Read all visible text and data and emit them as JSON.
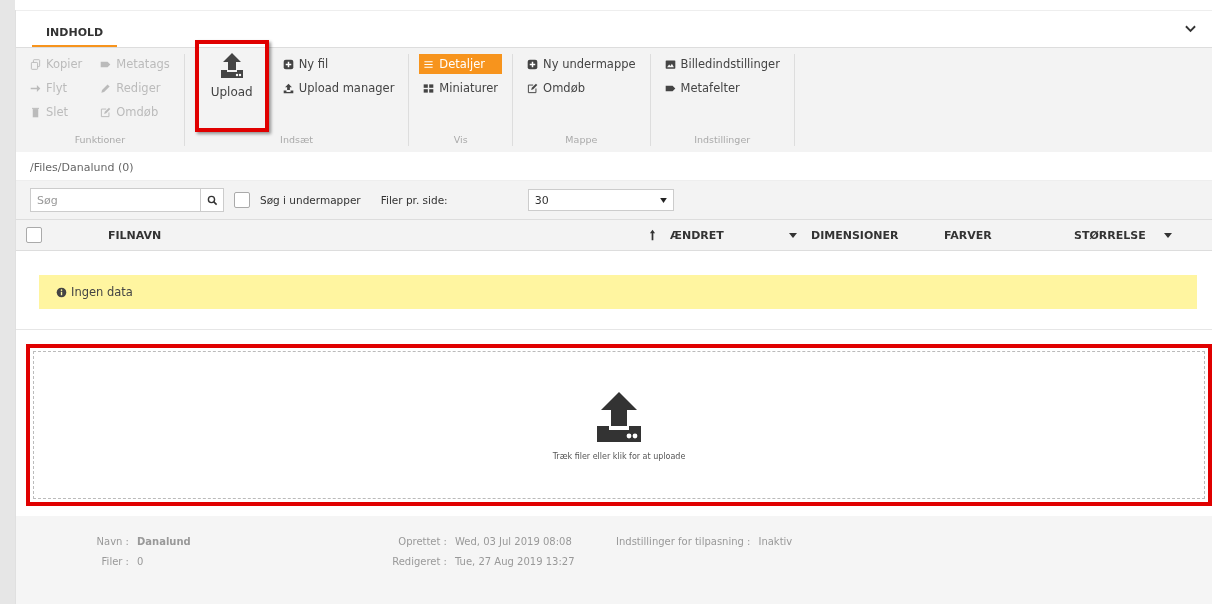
{
  "tabs": [
    {
      "label": "INDHOLD",
      "selected": true
    }
  ],
  "ribbon": {
    "groups": [
      {
        "label": "Funktioner",
        "columns": [
          [
            {
              "label": "Kopier",
              "disabled": true
            },
            {
              "label": "Flyt",
              "disabled": true
            },
            {
              "label": "Slet",
              "disabled": true
            }
          ],
          [
            {
              "label": "Metatags",
              "disabled": true
            },
            {
              "label": "Rediger",
              "disabled": true
            },
            {
              "label": "Omdøb",
              "disabled": true
            }
          ]
        ]
      },
      {
        "label": "Indsæt",
        "big": {
          "label": "Upload",
          "highlighted": true
        },
        "columns": [
          [
            {
              "label": "Ny fil",
              "disabled": false
            },
            {
              "label": "Upload manager",
              "disabled": false
            }
          ]
        ]
      },
      {
        "label": "Vis",
        "columns": [
          [
            {
              "label": "Detaljer",
              "selected": true
            },
            {
              "label": "Miniaturer",
              "selected": false
            }
          ]
        ]
      },
      {
        "label": "Mappe",
        "columns": [
          [
            {
              "label": "Ny undermappe",
              "disabled": false
            },
            {
              "label": "Omdøb",
              "disabled": false
            }
          ]
        ]
      },
      {
        "label": "Indstillinger",
        "columns": [
          [
            {
              "label": "Billedindstillinger",
              "disabled": false
            },
            {
              "label": "Metafelter",
              "disabled": false
            }
          ]
        ]
      }
    ]
  },
  "path": "/Files/Danalund (0)",
  "toolbar": {
    "search": {
      "placeholder": "Søg"
    },
    "subfolders": {
      "label": "Søg i undermapper",
      "checked": false
    },
    "per_page_label": "Filer pr. side:",
    "per_page": "30"
  },
  "table": {
    "all_checked": false,
    "columns": [
      {
        "label": "FILNAVN",
        "sorted": true,
        "menu": false
      },
      {
        "label": "ÆNDRET",
        "sorted": false,
        "menu": true
      },
      {
        "label": "DIMENSIONER",
        "sorted": false,
        "menu": false
      },
      {
        "label": "FARVER",
        "sorted": false,
        "menu": false
      },
      {
        "label": "STØRRELSE",
        "sorted": false,
        "menu": true
      }
    ],
    "empty_message": "Ingen data"
  },
  "dropzone": {
    "text": "Træk filer eller klik for at uploade",
    "highlighted": true
  },
  "info": [
    [
      {
        "label": "Navn :",
        "value": "Danalund",
        "bold": true
      },
      {
        "label": "Filer :",
        "value": "0",
        "bold": false
      }
    ],
    [
      {
        "label": "Oprettet :",
        "value": "Wed, 03 Jul 2019 08:08",
        "bold": false
      },
      {
        "label": "Redigeret :",
        "value": "Tue, 27 Aug 2019 13:27",
        "bold": false
      }
    ],
    [
      {
        "label": "Indstillinger for tilpasning :",
        "value": "Inaktiv",
        "bold": false
      }
    ]
  ]
}
